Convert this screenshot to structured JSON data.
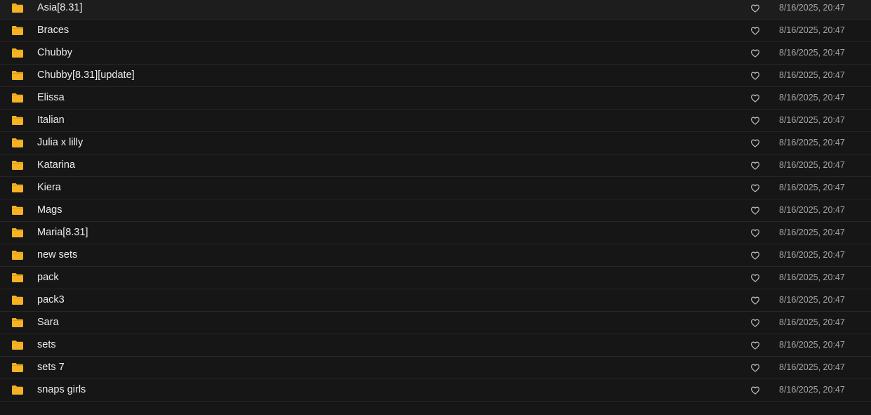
{
  "colors": {
    "background": "#161616",
    "row_divider": "#262626",
    "folder": "#f5b223",
    "text": "#ececec",
    "muted_text": "#a6a6a6"
  },
  "icons": {
    "folder": "folder-icon",
    "favorite": "heart-outline-icon"
  },
  "files": [
    {
      "name": "Asia[8.31]",
      "modified": "8/16/2025, 20:47"
    },
    {
      "name": "Braces",
      "modified": "8/16/2025, 20:47"
    },
    {
      "name": "Chubby",
      "modified": "8/16/2025, 20:47"
    },
    {
      "name": "Chubby[8.31][update]",
      "modified": "8/16/2025, 20:47"
    },
    {
      "name": "Elissa",
      "modified": "8/16/2025, 20:47"
    },
    {
      "name": "Italian",
      "modified": "8/16/2025, 20:47"
    },
    {
      "name": "Julia x lilly",
      "modified": "8/16/2025, 20:47"
    },
    {
      "name": "Katarina",
      "modified": "8/16/2025, 20:47"
    },
    {
      "name": "Kiera",
      "modified": "8/16/2025, 20:47"
    },
    {
      "name": "Mags",
      "modified": "8/16/2025, 20:47"
    },
    {
      "name": "Maria[8.31]",
      "modified": "8/16/2025, 20:47"
    },
    {
      "name": "new sets",
      "modified": "8/16/2025, 20:47"
    },
    {
      "name": "pack",
      "modified": "8/16/2025, 20:47"
    },
    {
      "name": "pack3",
      "modified": "8/16/2025, 20:47"
    },
    {
      "name": "Sara",
      "modified": "8/16/2025, 20:47"
    },
    {
      "name": "sets",
      "modified": "8/16/2025, 20:47"
    },
    {
      "name": "sets 7",
      "modified": "8/16/2025, 20:47"
    },
    {
      "name": "snaps girls",
      "modified": "8/16/2025, 20:47"
    }
  ]
}
